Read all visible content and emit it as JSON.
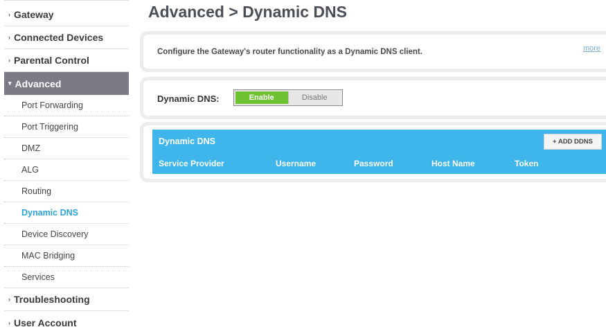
{
  "sidebar": {
    "top_items": [
      {
        "label": "Gateway"
      },
      {
        "label": "Connected Devices"
      },
      {
        "label": "Parental Control"
      },
      {
        "label": "Advanced"
      }
    ],
    "sub_items": [
      {
        "label": "Port Forwarding"
      },
      {
        "label": "Port Triggering"
      },
      {
        "label": "DMZ"
      },
      {
        "label": "ALG"
      },
      {
        "label": "Routing"
      },
      {
        "label": "Dynamic DNS"
      },
      {
        "label": "Device Discovery"
      },
      {
        "label": "MAC Bridging"
      },
      {
        "label": "Services"
      }
    ],
    "bottom_items": [
      {
        "label": "Troubleshooting"
      },
      {
        "label": "User Account"
      }
    ],
    "caret_closed": "›",
    "caret_open": "▾"
  },
  "main": {
    "title": "Advanced > Dynamic DNS",
    "description": "Configure the Gateway's router functionality as a Dynamic DNS client.",
    "more_link": "more",
    "toggle": {
      "label": "Dynamic DNS:",
      "enable": "Enable",
      "disable": "Disable",
      "selected": "Enable"
    },
    "table": {
      "title": "Dynamic DNS",
      "add_button": "+ ADD DDNS",
      "columns": [
        "Service Provider",
        "Username",
        "Password",
        "Host Name",
        "Token"
      ]
    }
  },
  "colors": {
    "active_nav_bg": "#7b7b86",
    "current_sub_text": "#2aa3dd",
    "enable_green": "#6cc230",
    "table_header_blue": "#3eb6ec"
  }
}
